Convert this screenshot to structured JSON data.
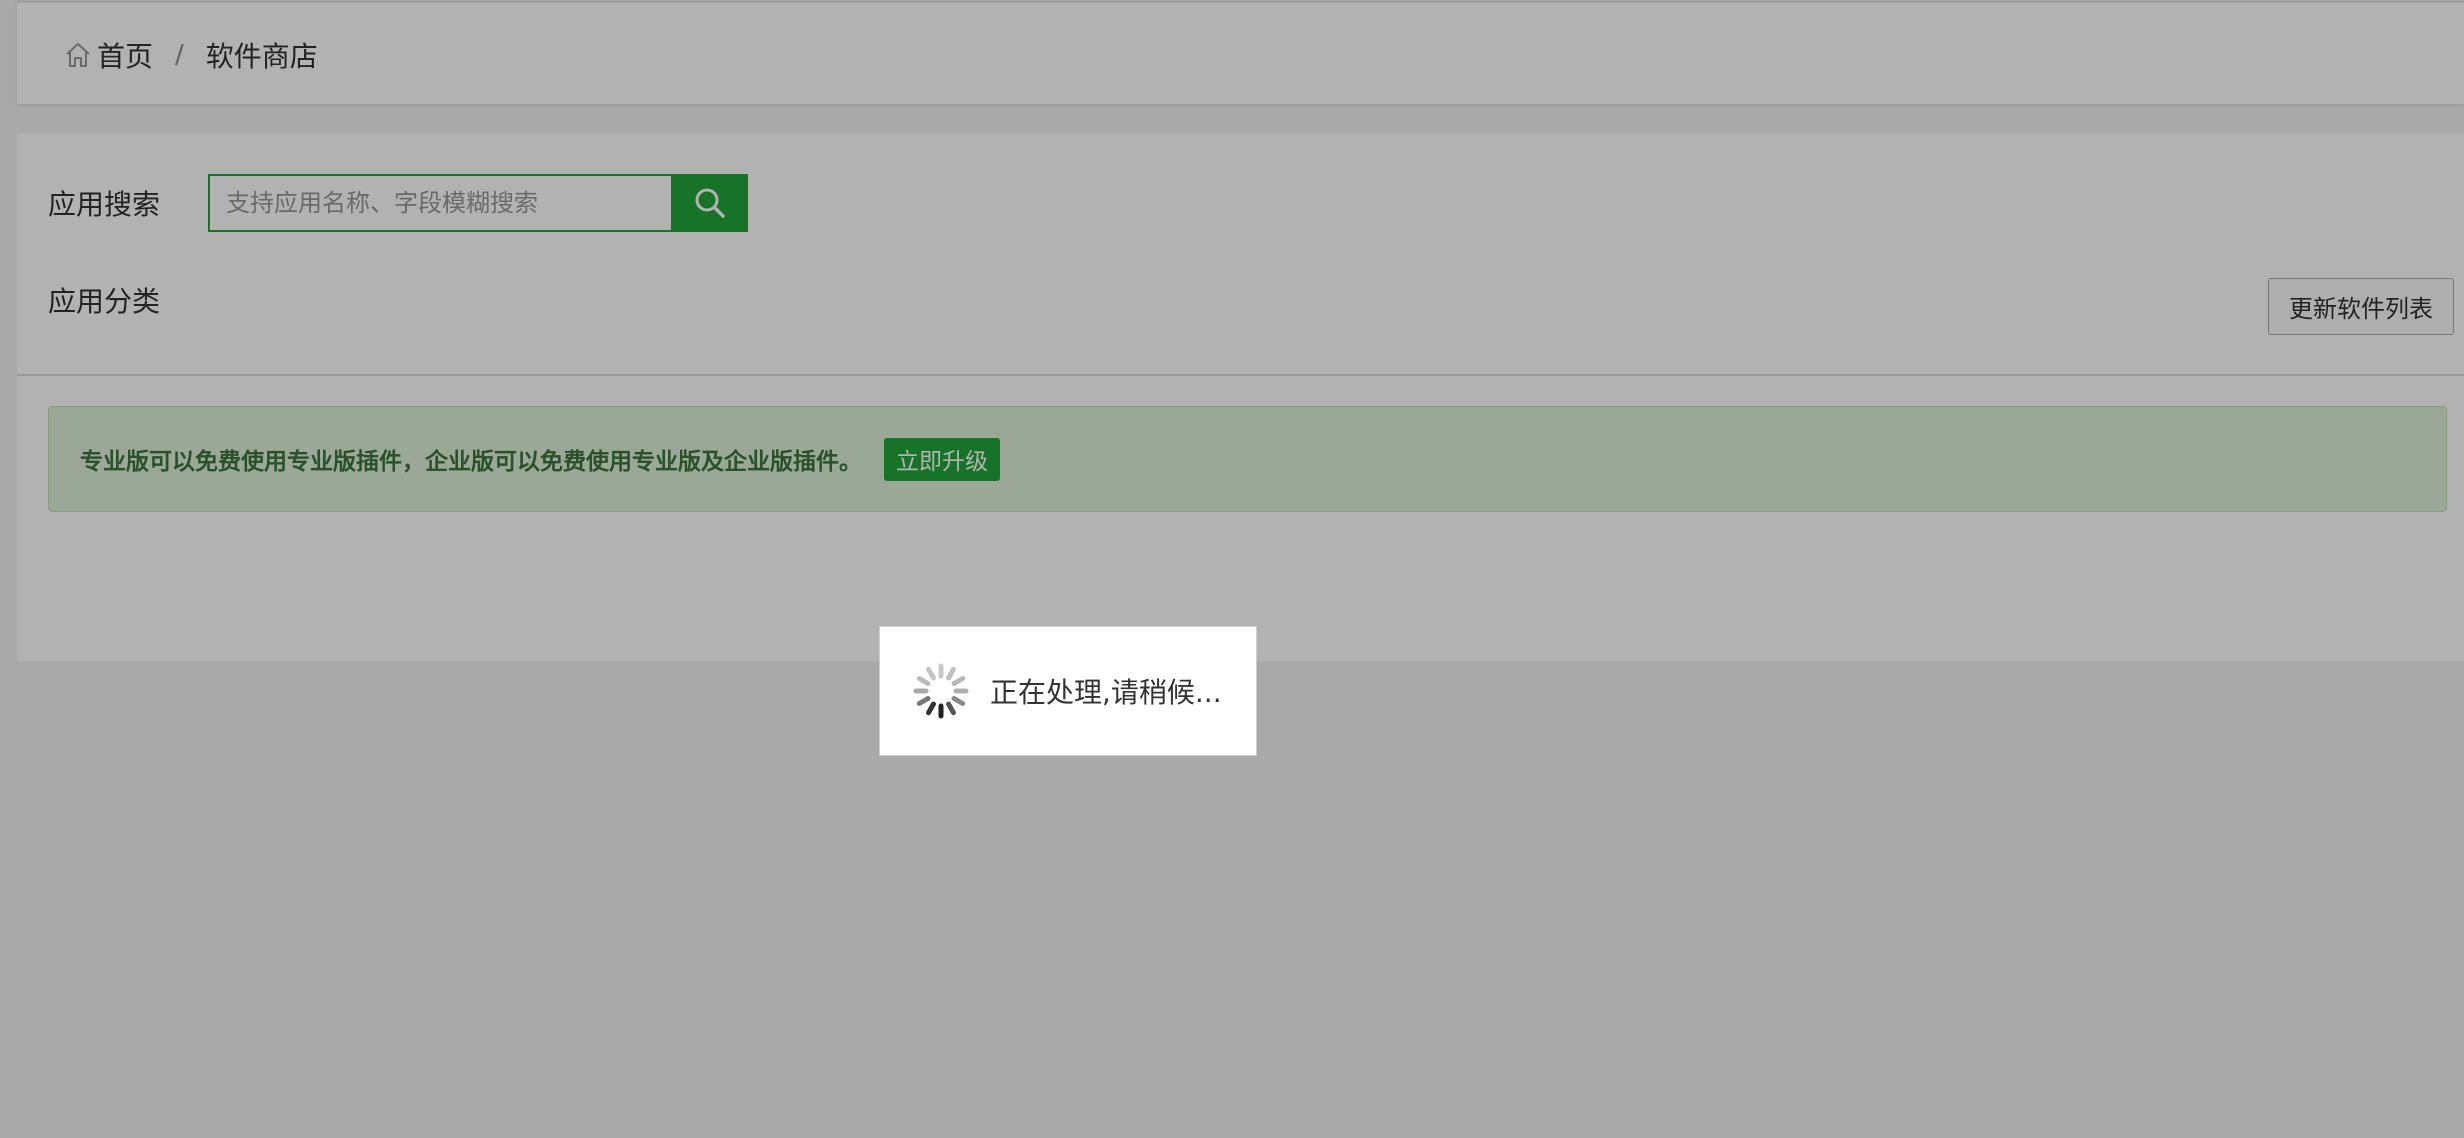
{
  "breadcrumb": {
    "home": "首页",
    "separator": "/",
    "current": "软件商店"
  },
  "search": {
    "label": "应用搜索",
    "placeholder": "支持应用名称、字段模糊搜索"
  },
  "category": {
    "label": "应用分类"
  },
  "toolbar": {
    "update_label": "更新软件列表"
  },
  "notice": {
    "text": "专业版可以免费使用专业版插件，企业版可以免费使用专业版及企业版插件。",
    "upgrade_label": "立即升级"
  },
  "loading": {
    "text": "正在处理,请稍候..."
  },
  "colors": {
    "accent": "#20a53a",
    "notice_bg": "#dff0d8",
    "notice_text": "#3c763d",
    "overlay": "rgba(0,0,0,0.3)"
  },
  "icons": {
    "home": "home-icon",
    "search": "search-icon",
    "spinner": "spinner-icon"
  }
}
